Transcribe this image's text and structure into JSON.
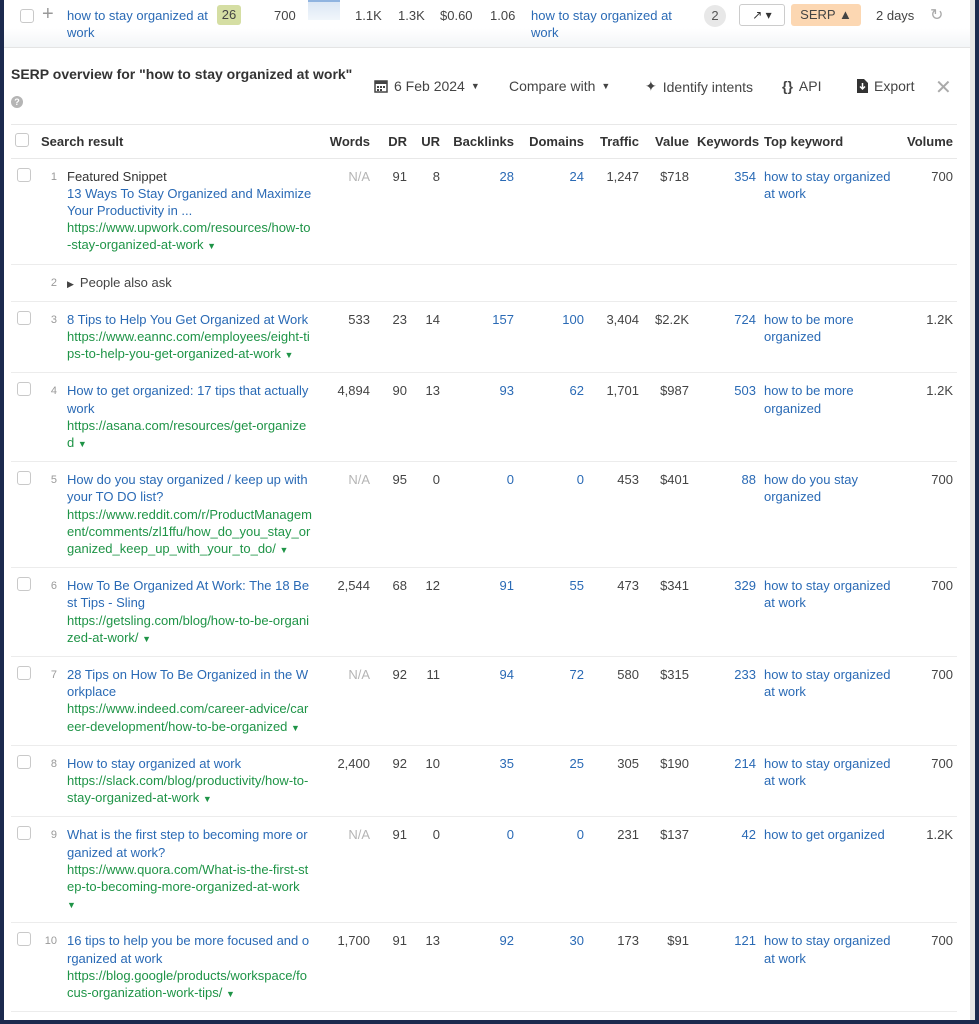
{
  "keyword_row": {
    "keyword": "how to stay organized at work",
    "kd": "26",
    "volume": "700",
    "traffic_potential": "1.1K",
    "global_volume": "1.3K",
    "cpc": "$0.60",
    "cps": "1.06",
    "parent_topic": "how to stay organized at work",
    "serp_features_count": "2",
    "trend_button": "↗ ▾",
    "serp_button": "SERP ▲",
    "updated": "2 days",
    "add_icon": "+",
    "refresh_icon": "↻"
  },
  "panel": {
    "title": "SERP overview for \"how to stay organized at work\"",
    "help_icon": "?",
    "date": "6 Feb 2024",
    "compare_with": "Compare with",
    "identify_intents": "Identify intents",
    "api": "API",
    "export": "Export",
    "close_icon": "✕"
  },
  "table": {
    "headers": {
      "search_result": "Search result",
      "words": "Words",
      "dr": "DR",
      "ur": "UR",
      "backlinks": "Backlinks",
      "domains": "Domains",
      "traffic": "Traffic",
      "value": "Value",
      "keywords": "Keywords",
      "top_keyword": "Top keyword",
      "volume": "Volume"
    },
    "rows": [
      {
        "pos": "1",
        "feature": "Featured Snippet",
        "title": "13 Ways To Stay Organized and Maximize Your Productivity in ...",
        "url": "https://www.upwork.com/resources/how-to-stay-organized-at-work",
        "words": "N/A",
        "dr": "91",
        "ur": "8",
        "backlinks": "28",
        "domains": "24",
        "traffic": "1,247",
        "value": "$718",
        "keywords": "354",
        "top_keyword": "how to stay organized at work",
        "volume": "700"
      },
      {
        "pos": "2",
        "paa": "People also ask"
      },
      {
        "pos": "3",
        "title": "8 Tips to Help You Get Organized at Work",
        "url": "https://www.eannc.com/employees/eight-tips-to-help-you-get-organized-at-work",
        "words": "533",
        "dr": "23",
        "ur": "14",
        "backlinks": "157",
        "domains": "100",
        "traffic": "3,404",
        "value": "$2.2K",
        "keywords": "724",
        "top_keyword": "how to be more organized",
        "volume": "1.2K"
      },
      {
        "pos": "4",
        "title": "How to get organized: 17 tips that actually work",
        "url": "https://asana.com/resources/get-organized",
        "words": "4,894",
        "dr": "90",
        "ur": "13",
        "backlinks": "93",
        "domains": "62",
        "traffic": "1,701",
        "value": "$987",
        "keywords": "503",
        "top_keyword": "how to be more organized",
        "volume": "1.2K"
      },
      {
        "pos": "5",
        "title": "How do you stay organized / keep up with your TO DO list?",
        "url": "https://www.reddit.com/r/ProductManagement/comments/zl1ffu/how_do_you_stay_organized_keep_up_with_your_to_do/",
        "words": "N/A",
        "dr": "95",
        "ur": "0",
        "backlinks": "0",
        "domains": "0",
        "traffic": "453",
        "value": "$401",
        "keywords": "88",
        "top_keyword": "how do you stay organized",
        "volume": "700"
      },
      {
        "pos": "6",
        "title": "How To Be Organized At Work: The 18 Best Tips - Sling",
        "url": "https://getsling.com/blog/how-to-be-organized-at-work/",
        "words": "2,544",
        "dr": "68",
        "ur": "12",
        "backlinks": "91",
        "domains": "55",
        "traffic": "473",
        "value": "$341",
        "keywords": "329",
        "top_keyword": "how to stay organized at work",
        "volume": "700"
      },
      {
        "pos": "7",
        "title": "28 Tips on How To Be Organized in the Workplace",
        "url": "https://www.indeed.com/career-advice/career-development/how-to-be-organized",
        "words": "N/A",
        "dr": "92",
        "ur": "11",
        "backlinks": "94",
        "domains": "72",
        "traffic": "580",
        "value": "$315",
        "keywords": "233",
        "top_keyword": "how to stay organized at work",
        "volume": "700"
      },
      {
        "pos": "8",
        "title": "How to stay organized at work",
        "url": "https://slack.com/blog/productivity/how-to-stay-organized-at-work",
        "words": "2,400",
        "dr": "92",
        "ur": "10",
        "backlinks": "35",
        "domains": "25",
        "traffic": "305",
        "value": "$190",
        "keywords": "214",
        "top_keyword": "how to stay organized at work",
        "volume": "700"
      },
      {
        "pos": "9",
        "title": "What is the first step to becoming more organized at work?",
        "url": "https://www.quora.com/What-is-the-first-step-to-becoming-more-organized-at-work",
        "words": "N/A",
        "dr": "91",
        "ur": "0",
        "backlinks": "0",
        "domains": "0",
        "traffic": "231",
        "value": "$137",
        "keywords": "42",
        "top_keyword": "how to get organized",
        "volume": "1.2K"
      },
      {
        "pos": "10",
        "title": "16 tips to help you be more focused and organized at work",
        "url": "https://blog.google/products/workspace/focus-organization-work-tips/",
        "words": "1,700",
        "dr": "91",
        "ur": "13",
        "backlinks": "92",
        "domains": "30",
        "traffic": "173",
        "value": "$91",
        "keywords": "121",
        "top_keyword": "how to stay organized at work",
        "volume": "700"
      }
    ]
  }
}
